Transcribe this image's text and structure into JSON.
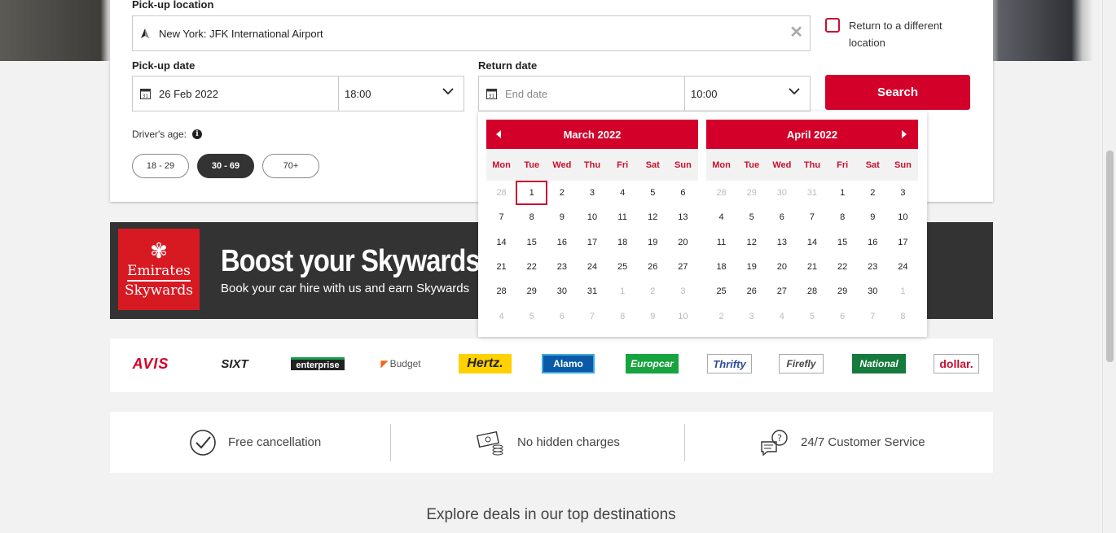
{
  "form": {
    "pickup_location_label": "Pick-up location",
    "pickup_location_value": "New York: JFK International Airport",
    "return_different_label": "Return to a different location",
    "pickup_date_label": "Pick-up date",
    "pickup_date_value": "26 Feb 2022",
    "pickup_time_value": "18:00",
    "return_date_label": "Return date",
    "return_date_placeholder": "End date",
    "return_time_value": "10:00",
    "search_label": "Search",
    "driver_age_label": "Driver's age:",
    "ages": [
      {
        "label": "18 - 29",
        "selected": false
      },
      {
        "label": "30 - 69",
        "selected": true
      },
      {
        "label": "70+",
        "selected": false
      }
    ]
  },
  "calendar": {
    "weekdays": [
      "Mon",
      "Tue",
      "Wed",
      "Thu",
      "Fri",
      "Sat",
      "Sun"
    ],
    "months": [
      {
        "title": "March 2022",
        "weeks": [
          [
            "28",
            "1",
            "2",
            "3",
            "4",
            "5",
            "6"
          ],
          [
            "7",
            "8",
            "9",
            "10",
            "11",
            "12",
            "13"
          ],
          [
            "14",
            "15",
            "16",
            "17",
            "18",
            "19",
            "20"
          ],
          [
            "21",
            "22",
            "23",
            "24",
            "25",
            "26",
            "27"
          ],
          [
            "28",
            "29",
            "30",
            "31",
            "1",
            "2",
            "3"
          ],
          [
            "4",
            "5",
            "6",
            "7",
            "8",
            "9",
            "10"
          ]
        ],
        "leading_muted": 1,
        "trailing_muted": 10,
        "highlighted_day": "1"
      },
      {
        "title": "April 2022",
        "weeks": [
          [
            "28",
            "29",
            "30",
            "31",
            "1",
            "2",
            "3"
          ],
          [
            "4",
            "5",
            "6",
            "7",
            "8",
            "9",
            "10"
          ],
          [
            "11",
            "12",
            "13",
            "14",
            "15",
            "16",
            "17"
          ],
          [
            "18",
            "19",
            "20",
            "21",
            "22",
            "23",
            "24"
          ],
          [
            "25",
            "26",
            "27",
            "28",
            "29",
            "30",
            "1"
          ],
          [
            "2",
            "3",
            "4",
            "5",
            "6",
            "7",
            "8"
          ]
        ],
        "leading_muted": 4,
        "trailing_muted": 8,
        "highlighted_day": null
      }
    ]
  },
  "banner": {
    "logo_line1": "Emirates",
    "logo_line2": "Skywards",
    "title": "Boost your Skywards",
    "subtitle": "Book your car hire with us and earn Skywards"
  },
  "brands": [
    "AVIS",
    "SIXT",
    "enterprise",
    "Budget",
    "Hertz.",
    "Alamo",
    "Europcar",
    "Thrifty",
    "Firefly",
    "National",
    "dollar."
  ],
  "features": [
    {
      "label": "Free cancellation",
      "icon": "check-circle-icon"
    },
    {
      "label": "No hidden charges",
      "icon": "cash-coins-icon"
    },
    {
      "label": "24/7 Customer Service",
      "icon": "chat-question-icon"
    }
  ],
  "explore_heading": "Explore deals in our top destinations",
  "colors": {
    "accent": "#d3002a",
    "dark": "#333333"
  }
}
